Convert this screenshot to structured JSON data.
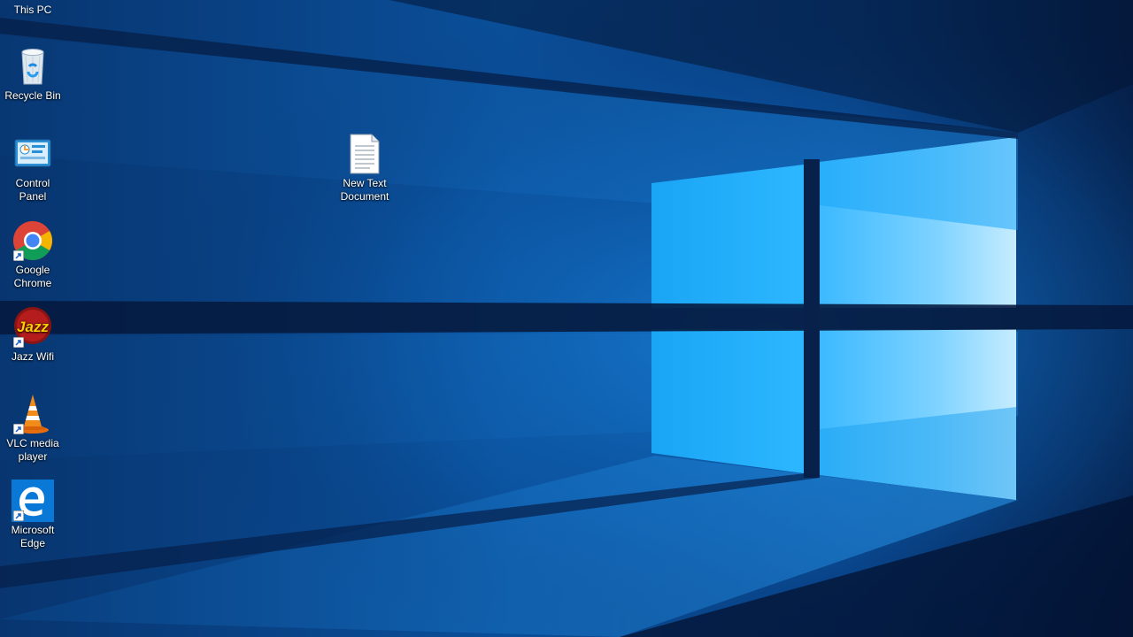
{
  "desktop": {
    "icons": [
      {
        "label": "This PC",
        "icon": "this-pc-icon"
      },
      {
        "label": "Recycle Bin",
        "icon": "recycle-bin-icon"
      },
      {
        "label": "Control Panel",
        "icon": "control-panel-icon"
      },
      {
        "label": "Google Chrome",
        "icon": "chrome-icon"
      },
      {
        "label": "Jazz Wifi",
        "icon": "jazz-wifi-icon"
      },
      {
        "label": "VLC media player",
        "icon": "vlc-icon"
      },
      {
        "label": "Microsoft Edge",
        "icon": "edge-icon"
      },
      {
        "label": "New Text Document",
        "icon": "text-document-icon"
      }
    ],
    "jazz_logo_text": "Jazz"
  },
  "colors": {
    "wallpaper_dark": "#071a3d",
    "wallpaper_mid": "#0b5fb3",
    "window_light": "#4cc2ff",
    "window_bright": "#b8e6ff"
  }
}
